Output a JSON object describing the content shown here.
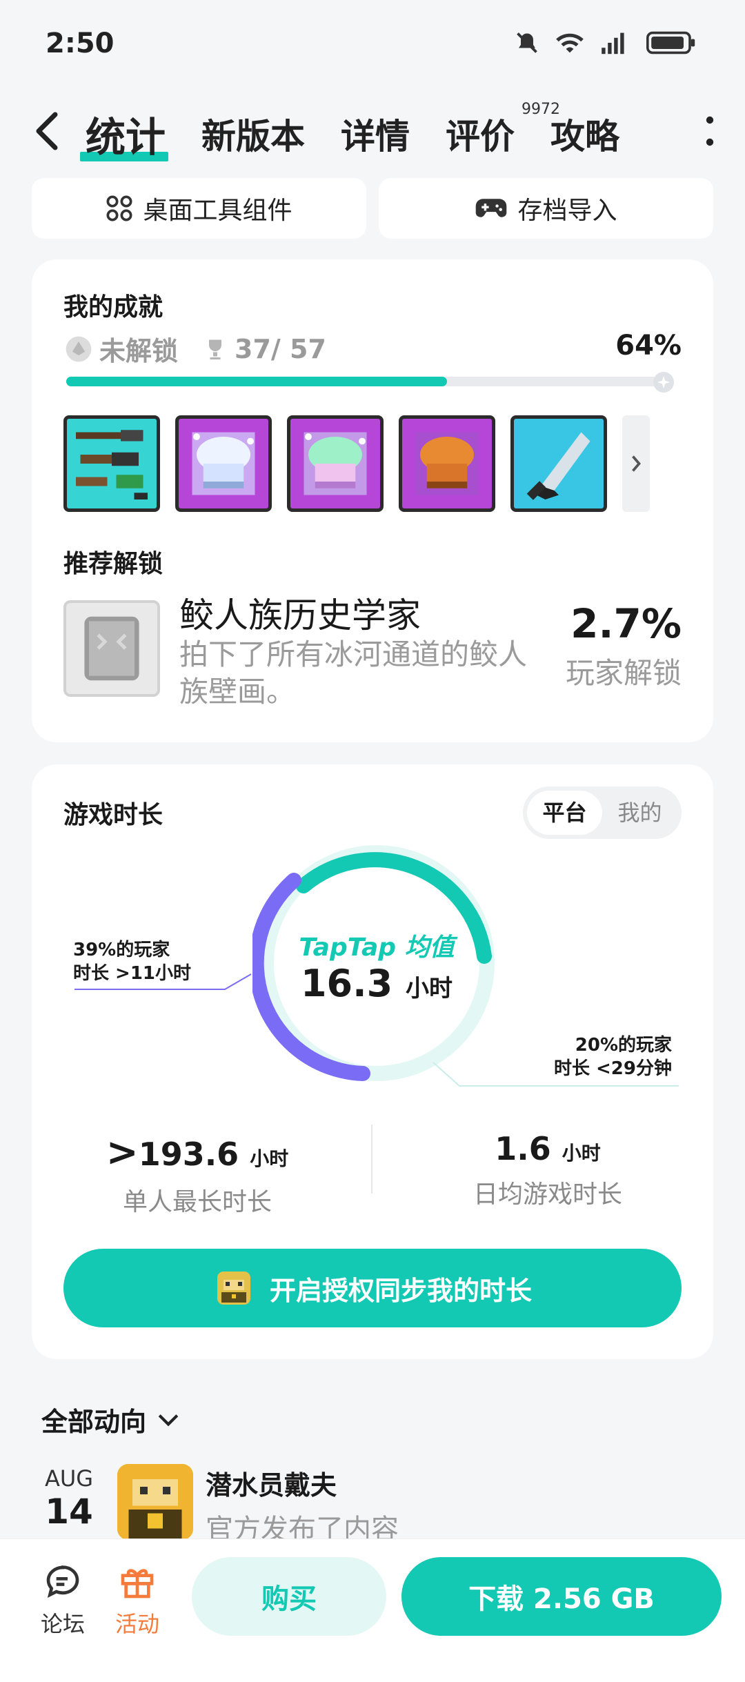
{
  "status_bar": {
    "time": "2:50"
  },
  "nav": {
    "tabs": [
      {
        "label": "统计",
        "active": true
      },
      {
        "label": "新版本"
      },
      {
        "label": "详情"
      },
      {
        "label": "评价",
        "badge": "9972"
      },
      {
        "label": "攻略"
      }
    ]
  },
  "quick_buttons": {
    "widget": "桌面工具组件",
    "save_import": "存档导入"
  },
  "achievements": {
    "title": "我的成就",
    "locked_label": "未解锁",
    "progress_text": "37/ 57",
    "percent_text": "64%",
    "progress": 0.64,
    "recommend_title": "推荐解锁",
    "recommend": {
      "name": "鲛人族历史学家",
      "desc": "拍下了所有冰河通道的鲛人族壁画。",
      "rate": "2.7%",
      "rate_label": "玩家解锁"
    }
  },
  "playtime": {
    "title": "游戏时长",
    "segment": [
      "平台",
      "我的"
    ],
    "donut_label": "TapTap 均值",
    "donut_value": "16.3",
    "donut_unit": "小时",
    "anno_left_1": "39%的玩家",
    "anno_left_2": "时长 >11小时",
    "anno_right_1": "20%的玩家",
    "anno_right_2": "时长 <29分钟",
    "max_prefix": ">",
    "max_value": "193.6",
    "max_unit": "小时",
    "max_label": "单人最长时长",
    "daily_value": "1.6",
    "daily_unit": "小时",
    "daily_label": "日均游戏时长",
    "sync_button": "开启授权同步我的时长",
    "colors": {
      "accent": "#14c9b3",
      "purple": "#7a6cf5",
      "light": "#e3f8f5"
    }
  },
  "feed": {
    "header": "全部动向",
    "month": "AUG",
    "day": "14",
    "author": "潜水员戴夫",
    "text": "官方发布了内容"
  },
  "bottom_bar": {
    "forum": "论坛",
    "activity": "活动",
    "buy": "购买",
    "download": "下载 2.56 GB"
  }
}
